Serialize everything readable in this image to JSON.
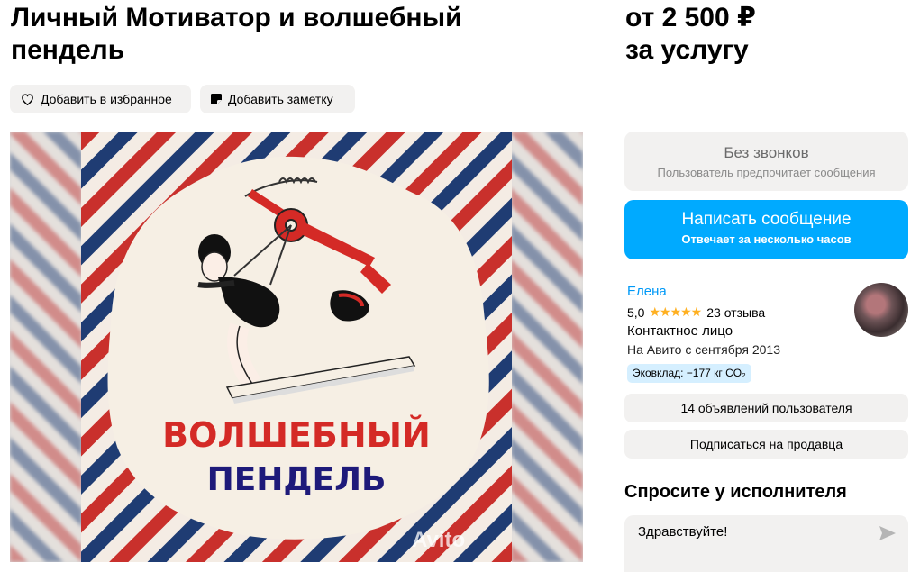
{
  "listing": {
    "title": "Личный Мотиватор и волшебный пендель",
    "price_line1": "от 2 500 ₽",
    "price_line2": "за услугу"
  },
  "actions": {
    "favorite_label": "Добавить в избранное",
    "note_label": "Добавить заметку"
  },
  "image": {
    "headline1": "ВОЛШЕБНЫЙ",
    "headline2": "ПЕНДЕЛЬ",
    "watermark": "Avito"
  },
  "contact_panel": {
    "no_calls_title": "Без звонков",
    "no_calls_subtitle": "Пользователь предпочитает сообщения",
    "message_button_label": "Написать сообщение",
    "message_button_subtitle": "Отвечает за несколько часов"
  },
  "seller": {
    "name": "Елена",
    "rating": "5,0",
    "stars": "★★★★★",
    "reviews": "23 отзыва",
    "role": "Контактное лицо",
    "since": "На Авито с сентября 2013",
    "eco": "Эковклад: −177 кг CO₂",
    "ads_button_label": "14 объявлений пользователя",
    "subscribe_button_label": "Подписаться на продавца"
  },
  "ask": {
    "title": "Спросите у исполнителя",
    "input_value": "Здравствуйте!"
  },
  "colors": {
    "accent_blue": "#00aaff",
    "link_blue": "#0099f7",
    "star": "#ffb021",
    "stripe_red": "#c9302c",
    "stripe_navy": "#1f3c73"
  }
}
